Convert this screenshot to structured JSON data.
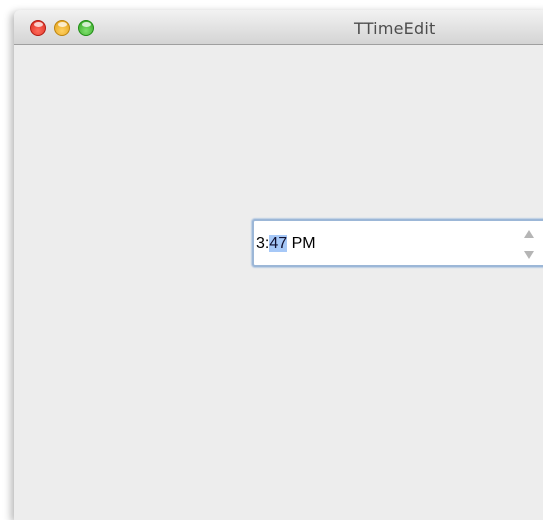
{
  "window": {
    "title": "TTimeEdit"
  },
  "time_edit": {
    "hour": "3",
    "separator": ":",
    "minutes_selected": "47",
    "period": " PM",
    "up_icon": "triangle-up-icon",
    "down_icon": "triangle-down-icon"
  },
  "colors": {
    "selection": "#a6c8f7",
    "focus_ring": "#9cb7d7",
    "window_background": "#ededed"
  }
}
